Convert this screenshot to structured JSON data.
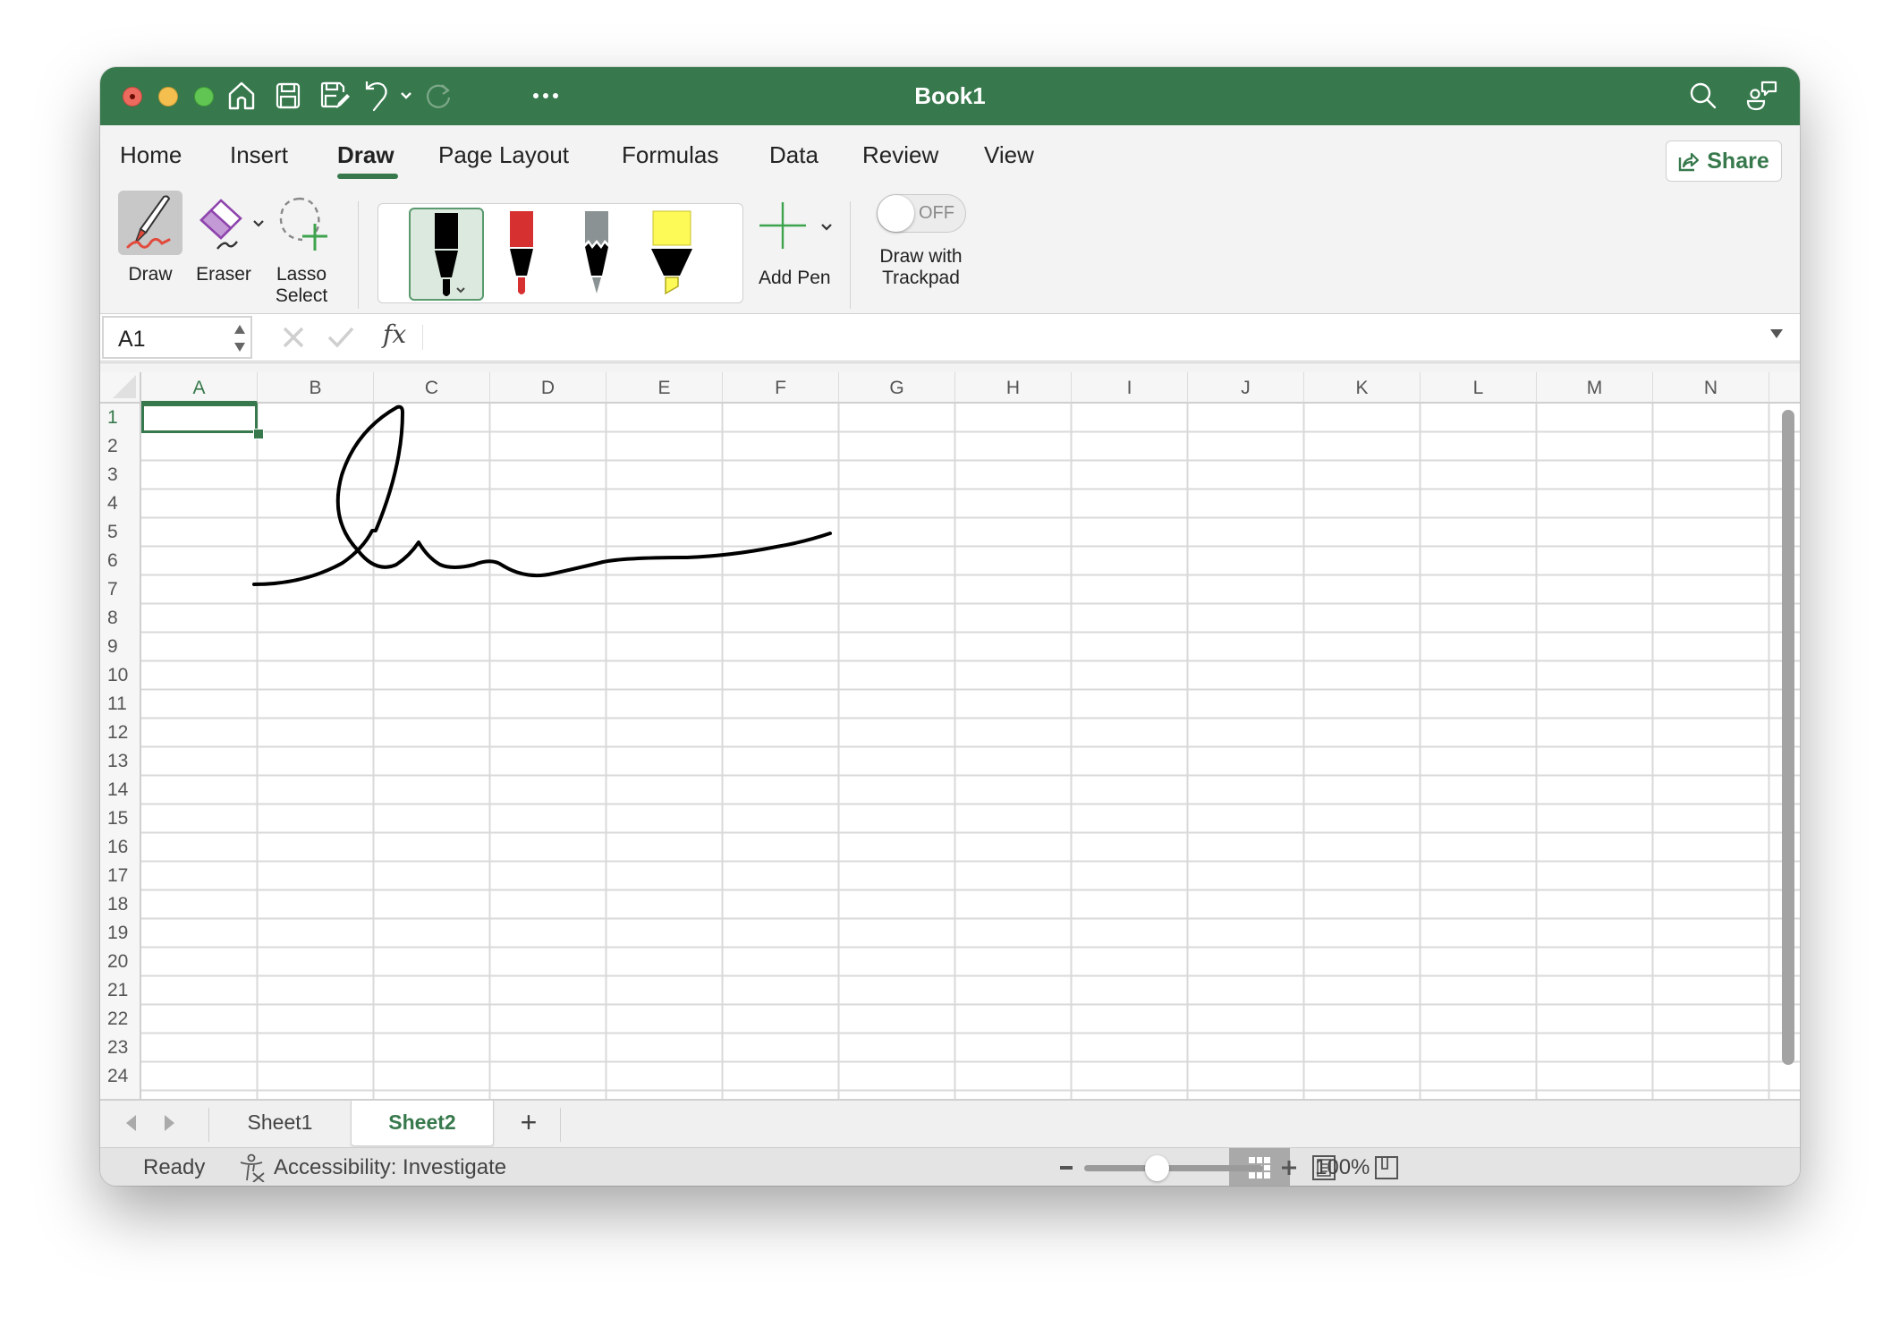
{
  "window": {
    "title": "Book1",
    "accent_color": "#37794c"
  },
  "quick_access": {
    "icons": [
      "home-icon",
      "save-icon",
      "save-as-icon",
      "undo-icon",
      "undo-dropdown-icon",
      "redo-icon",
      "more-icon"
    ]
  },
  "title_actions": {
    "icons": [
      "search-icon",
      "collaborate-icon"
    ]
  },
  "ribbon_tabs": [
    {
      "label": "Home",
      "active": false
    },
    {
      "label": "Insert",
      "active": false
    },
    {
      "label": "Draw",
      "active": true
    },
    {
      "label": "Page Layout",
      "active": false
    },
    {
      "label": "Formulas",
      "active": false
    },
    {
      "label": "Data",
      "active": false
    },
    {
      "label": "Review",
      "active": false
    },
    {
      "label": "View",
      "active": false
    }
  ],
  "share": {
    "label": "Share"
  },
  "ribbon": {
    "draw_label": "Draw",
    "eraser_label": "Eraser",
    "lasso_line1": "Lasso",
    "lasso_line2": "Select",
    "pens": [
      {
        "name": "black-pen",
        "color": "#000000",
        "selected": true
      },
      {
        "name": "red-pen",
        "color": "#d63030",
        "selected": false
      },
      {
        "name": "gray-pencil",
        "color": "#8a9294",
        "selected": false
      },
      {
        "name": "yellow-highlighter",
        "color": "#fdf957",
        "selected": false
      }
    ],
    "add_pen_label": "Add Pen",
    "trackpad_toggle_state": "OFF",
    "trackpad_line1": "Draw with",
    "trackpad_line2": "Trackpad"
  },
  "formula_bar": {
    "name_box": "A1",
    "fx_label": "fx",
    "formula_value": ""
  },
  "grid": {
    "columns": [
      "A",
      "B",
      "C",
      "D",
      "E",
      "F",
      "G",
      "H",
      "I",
      "J",
      "K",
      "L",
      "M",
      "N"
    ],
    "rows": [
      "1",
      "2",
      "3",
      "4",
      "5",
      "6",
      "7",
      "8",
      "9",
      "10",
      "11",
      "12",
      "13",
      "14",
      "15",
      "16",
      "17",
      "18",
      "19",
      "20",
      "21",
      "22",
      "23",
      "24"
    ],
    "selected_cell": "A1",
    "ink_stroke": "handwritten signature scribble across B3:F8"
  },
  "sheet_tabs": [
    {
      "label": "Sheet1",
      "active": false
    },
    {
      "label": "Sheet2",
      "active": true
    }
  ],
  "add_sheet_label": "+",
  "status_bar": {
    "ready": "Ready",
    "accessibility": "Accessibility: Investigate",
    "zoom_percent_label": "100%",
    "zoom_percent": 100
  }
}
